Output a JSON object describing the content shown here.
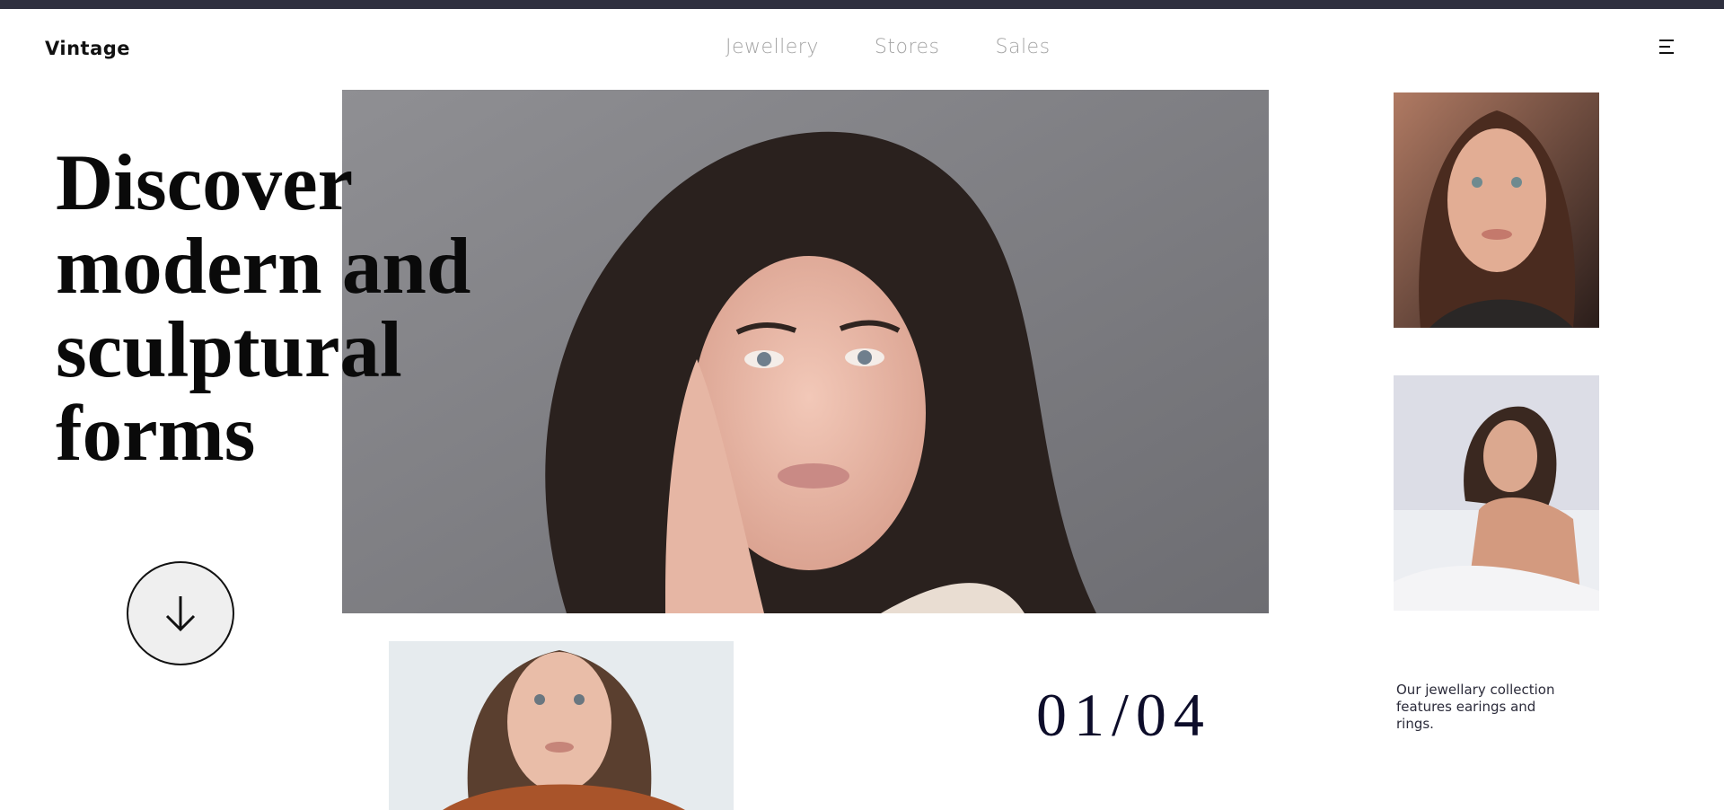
{
  "app": {
    "logo_text": "Vintage"
  },
  "nav": {
    "items": [
      {
        "label": "Jewellery"
      },
      {
        "label": "Stores"
      },
      {
        "label": "Sales"
      }
    ]
  },
  "header": {
    "menu_icon": "hamburger-menu-icon"
  },
  "hero": {
    "headline_lines": [
      "Discover",
      "modern and",
      "sculptural",
      "forms"
    ],
    "scroll_icon": "arrow-down-icon"
  },
  "slider": {
    "counter": "01/04"
  },
  "caption": {
    "text": "Our jewellary collection features earings and rings."
  },
  "colors": {
    "topbar": "#2f303f",
    "nav_text": "#a4a4a4",
    "headline_text": "#0a0a0a",
    "counter_text": "#0d0d2a",
    "scroll_button_bg": "#efefef"
  }
}
